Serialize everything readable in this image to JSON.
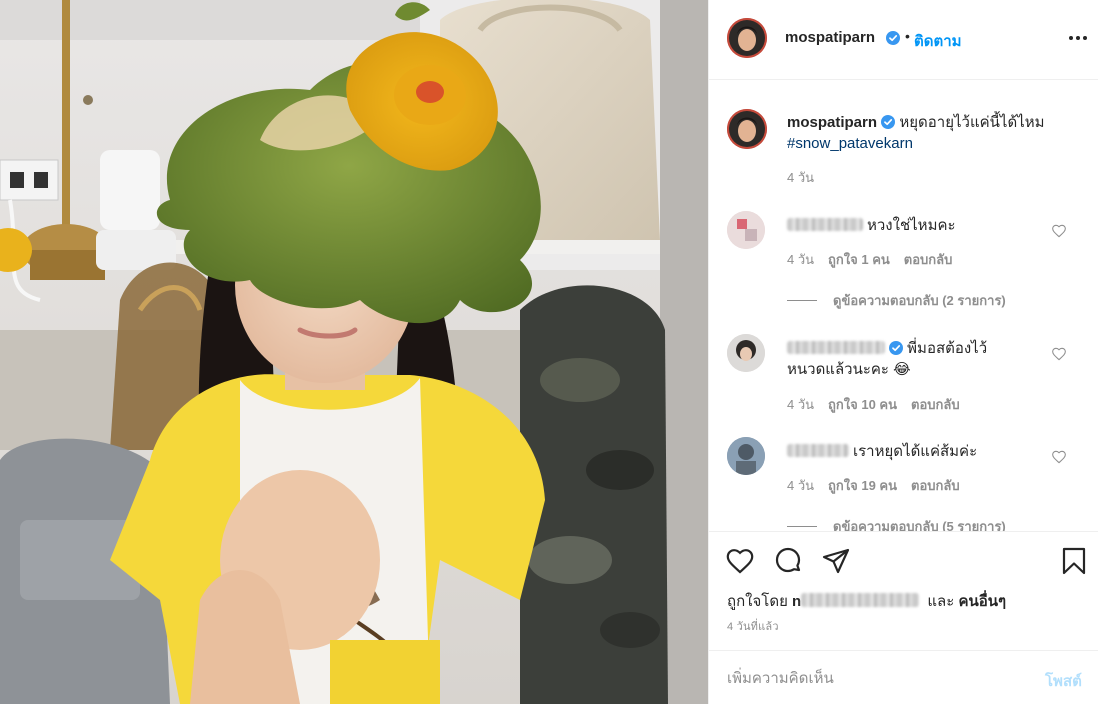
{
  "post": {
    "username": "mospatiparn",
    "follow_separator": "•",
    "follow_label": "ติดตาม"
  },
  "caption": {
    "username": "mospatiparn",
    "text": "หยุดอายุไว้แค่นี้ได้ไหม",
    "hashtag": "#snow_patavekarn",
    "time": "4 วัน"
  },
  "comments": [
    {
      "text": "หวงใช่ไหมคะ",
      "time": "4 วัน",
      "likes": "ถูกใจ 1 คน",
      "reply": "ตอบกลับ",
      "view_replies": "ดูข้อความตอบกลับ (2 รายการ)"
    },
    {
      "text_line1": "พี่มอสต้องไว้",
      "text_line2": "หนวดแล้วนะคะ 😂",
      "time": "4 วัน",
      "likes": "ถูกใจ 10 คน",
      "reply": "ตอบกลับ"
    },
    {
      "text": "เราหยุดได้แค่ส้มค่ะ",
      "time": "4 วัน",
      "likes": "ถูกใจ 19 คน",
      "reply": "ตอบกลับ",
      "view_replies": "ดูข้อความตอบกลับ (5 รายการ)"
    }
  ],
  "liked_by": {
    "prefix": "ถูกใจโดย",
    "visible_name_start": "n",
    "and": "และ",
    "others": "คนอื่นๆ"
  },
  "post_time": "4 วันที่แล้ว",
  "add_comment": {
    "placeholder": "เพิ่มความคิดเห็น",
    "post_label": "โพสต์"
  },
  "colors": {
    "link_blue": "#0095f6",
    "post_disabled": "#b2dffc",
    "hashtag": "#00376b",
    "muted": "#8e8e8e"
  },
  "icons": [
    "verified-badge-icon",
    "more-options-icon",
    "heart-icon",
    "comment-icon",
    "share-icon",
    "bookmark-icon"
  ]
}
